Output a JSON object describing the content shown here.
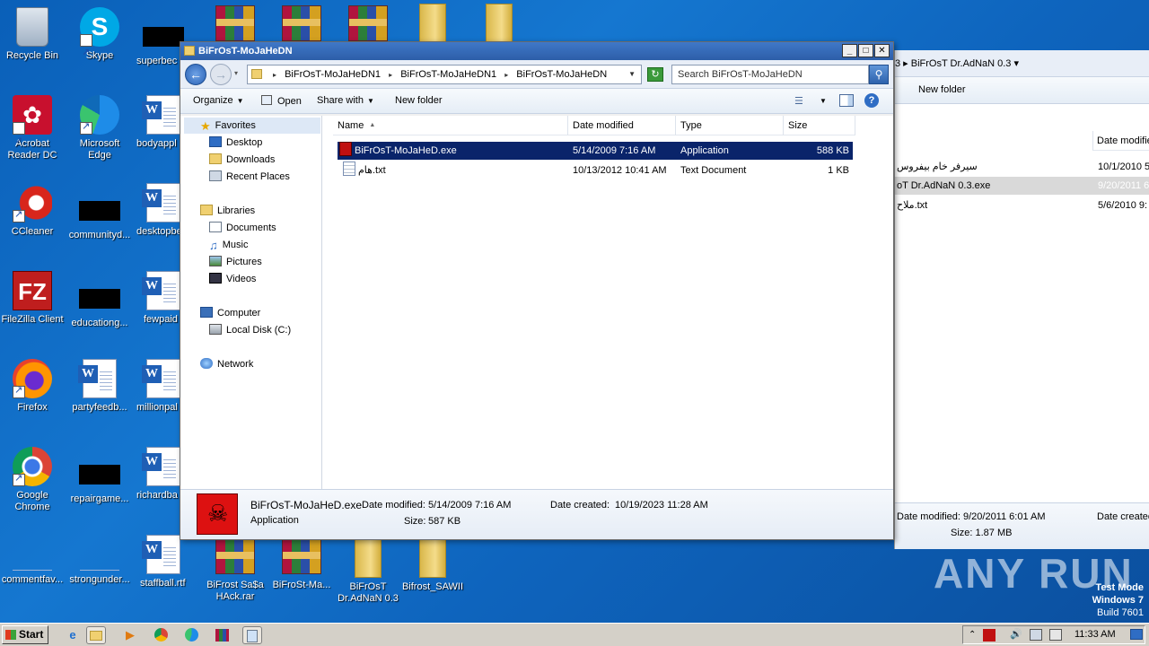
{
  "desktop": {
    "col1": [
      {
        "label": "Recycle Bin",
        "icon": "recycle-bin-icon"
      },
      {
        "label": "Acrobat Reader DC",
        "icon": "acrobat-icon"
      },
      {
        "label": "CCleaner",
        "icon": "ccleaner-icon"
      },
      {
        "label": "FileZilla Client",
        "icon": "filezilla-icon"
      },
      {
        "label": "Firefox",
        "icon": "firefox-icon"
      },
      {
        "label": "Google Chrome",
        "icon": "chrome-icon"
      },
      {
        "label": "commentfav...",
        "icon": "file-icon"
      }
    ],
    "col2": [
      {
        "label": "Skype",
        "icon": "skype-icon"
      },
      {
        "label": "Microsoft Edge",
        "icon": "edge-icon"
      },
      {
        "label": "communityd...",
        "icon": "black-thumbnail"
      },
      {
        "label": "educationg...",
        "icon": "black-thumbnail"
      },
      {
        "label": "partyfeedb...",
        "icon": "word-document-icon"
      },
      {
        "label": "repairgame...",
        "icon": "black-thumbnail"
      },
      {
        "label": "strongunder...",
        "icon": "file-icon"
      }
    ],
    "col3": [
      {
        "label": "superbec",
        "icon": "black-thumbnail"
      },
      {
        "label": "bodyappl",
        "icon": "word-document-icon"
      },
      {
        "label": "desktopbe",
        "icon": "word-document-icon"
      },
      {
        "label": "fewpaid",
        "icon": "word-document-icon"
      },
      {
        "label": "millionpal",
        "icon": "word-document-icon"
      },
      {
        "label": "richardba",
        "icon": "word-document-icon"
      },
      {
        "label": "staffball.rtf",
        "icon": "word-document-icon"
      }
    ],
    "bottom_row": [
      {
        "label": "BiFrost Sa$a HAck.rar",
        "icon": "winrar-icon"
      },
      {
        "label": "BiFroSt-Ma...",
        "icon": "winrar-icon"
      },
      {
        "label": "BiFrOsT Dr.AdNaN 0.3",
        "icon": "folder-icon"
      },
      {
        "label": "Bifrost_SAWII",
        "icon": "folder-icon"
      }
    ]
  },
  "explorer": {
    "title": "BiFrOsT-MoJaHeDN",
    "breadcrumb": [
      "BiFrOsT-MoJaHeDN1",
      "BiFrOsT-MoJaHeDN1",
      "BiFrOsT-MoJaHeDN"
    ],
    "search_placeholder": "Search BiFrOsT-MoJaHeDN",
    "toolbar": {
      "organize": "Organize",
      "open": "Open",
      "share_with": "Share with",
      "new_folder": "New folder"
    },
    "nav": {
      "favorites": "Favorites",
      "desktop": "Desktop",
      "downloads": "Downloads",
      "recent_places": "Recent Places",
      "libraries": "Libraries",
      "documents": "Documents",
      "music": "Music",
      "pictures": "Pictures",
      "videos": "Videos",
      "computer": "Computer",
      "local_disk": "Local Disk (C:)",
      "network": "Network"
    },
    "columns": {
      "name": "Name",
      "date_modified": "Date modified",
      "type": "Type",
      "size": "Size"
    },
    "files": [
      {
        "name": "BiFrOsT-MoJaHeD.exe",
        "date": "5/14/2009 7:16 AM",
        "type": "Application",
        "size": "588 KB"
      },
      {
        "name": "هام.txt",
        "date": "10/13/2012 10:41 AM",
        "type": "Text Document",
        "size": "1 KB"
      }
    ],
    "details": {
      "filename": "BiFrOsT-MoJaHeD.exe",
      "type": "Application",
      "modified_label": "Date modified:",
      "modified": "5/14/2009 7:16 AM",
      "size_label": "Size:",
      "size": "587 KB",
      "created_label": "Date created:",
      "created": "10/19/2023 11:28 AM"
    }
  },
  "bg_window": {
    "breadcrumb_tail": "BiFrOsT Dr.AdNaN 0.3",
    "new_folder": "New folder",
    "col_date": "Date modifie",
    "rows": [
      {
        "name": "سيرفر خام بيفروس",
        "date": "10/1/2010 5"
      },
      {
        "name": "oT Dr.AdNaN 0.3.exe",
        "date": "9/20/2011 6"
      },
      {
        "name": "ملاح.txt",
        "date": "5/6/2010 9:"
      }
    ],
    "details_modified": "Date modified: 9/20/2011 6:01 AM",
    "details_created": "Date created",
    "details_size": "Size: 1.87 MB"
  },
  "overlay": {
    "watermark": "ANY RUN",
    "test_mode": "Test Mode",
    "os": "Windows 7",
    "build": "Build 7601"
  },
  "taskbar": {
    "start": "Start",
    "clock": "11:33 AM"
  }
}
